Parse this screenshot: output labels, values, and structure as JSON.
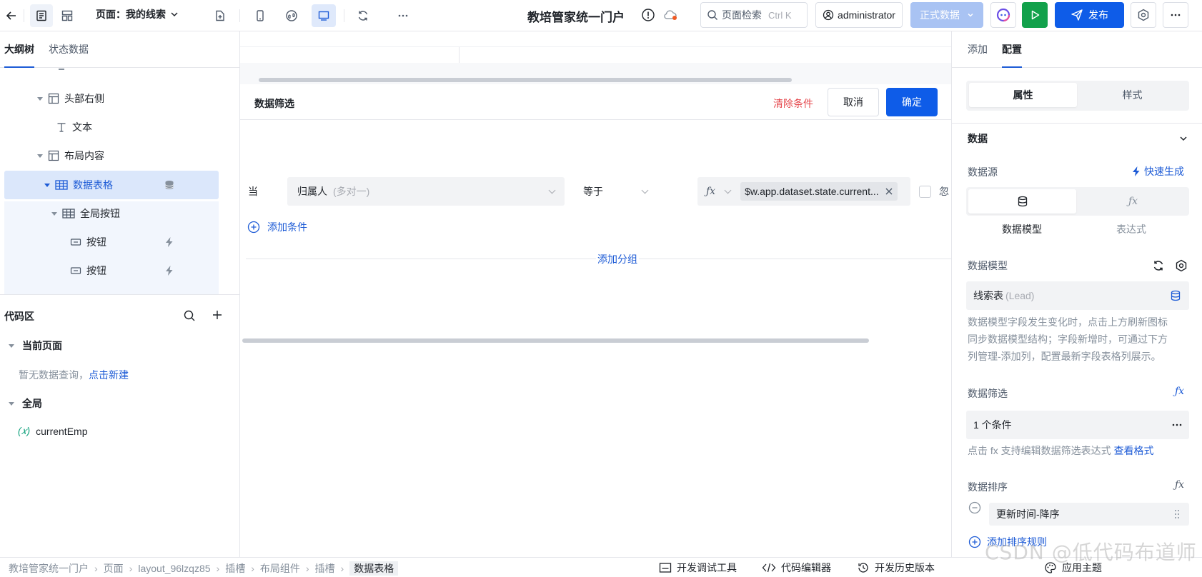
{
  "topbar": {
    "page_selector": "页面：我的线索",
    "app_title": "教培管家统一门户",
    "search": {
      "placeholder": "页面检索",
      "shortcut": "Ctrl K"
    },
    "user": "administrator",
    "env": "正式数据",
    "publish": "发布"
  },
  "left": {
    "tabs": [
      "大纲树",
      "状态数据"
    ],
    "tree": [
      {
        "label": "头部右侧",
        "icon": "layout-icon"
      },
      {
        "label": "文本",
        "icon": "text-icon"
      },
      {
        "label": "布局内容",
        "icon": "layout-icon"
      },
      {
        "label": "数据表格",
        "icon": "table-icon",
        "selected": true
      },
      {
        "label": "全局按钮",
        "icon": "table-icon"
      },
      {
        "label": "按钮",
        "icon": "button-icon"
      },
      {
        "label": "按钮",
        "icon": "button-icon"
      }
    ],
    "code": {
      "title": "代码区",
      "current_page": "当前页面",
      "empty_text": "暂无数据查询，",
      "create_link": "点击新建",
      "global": "全局",
      "global_var": "currentEmp"
    }
  },
  "center": {
    "filter": {
      "title": "数据筛选",
      "clear": "清除条件",
      "cancel": "取消",
      "confirm": "确定",
      "when": "当",
      "field": "归属人",
      "field_hint": "(多对一)",
      "operator": "等于",
      "fx": "ƒx",
      "value": "$w.app.dataset.state.current...",
      "ignore": "忽",
      "add_condition": "添加条件",
      "add_group": "添加分组"
    }
  },
  "right": {
    "tabs": [
      "添加",
      "配置"
    ],
    "seg": [
      "属性",
      "样式"
    ],
    "section": "数据",
    "datasource_label": "数据源",
    "quick_gen": "快速生成",
    "ds_opts": [
      "数据模型",
      "表达式"
    ],
    "model_label": "数据模型",
    "model_value": "线索表",
    "model_hint": "(Lead)",
    "model_desc": [
      "数据模型字段发生变化时，点击上方刷新图标",
      "同步数据模型结构；字段新增时，可通过下方",
      "列管理-添加列，配置最新字段表格列展示。"
    ],
    "filter_label": "数据筛选",
    "filter_value": "1 个条件",
    "filter_hint": "点击 fx 支持编辑数据筛选表达式",
    "filter_link": "查看格式",
    "sort_label": "数据排序",
    "sort_value": "更新时间-降序",
    "add_sort": "添加排序规则"
  },
  "bottom": {
    "breadcrumb": [
      "教培管家统一门户",
      "页面",
      "layout_96lzqz85",
      "插槽",
      "布局组件",
      "插槽",
      "数据表格"
    ],
    "tools": [
      "开发调试工具",
      "代码编辑器",
      "开发历史版本",
      "应用主题"
    ]
  },
  "watermark": "CSDN @低代码布道师"
}
